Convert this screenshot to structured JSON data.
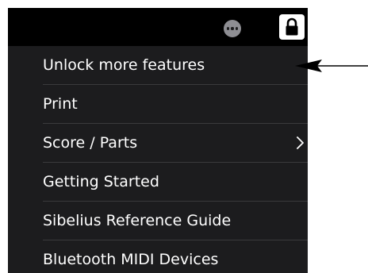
{
  "menu": {
    "items": [
      {
        "label": "Unlock more features",
        "has_submenu": false
      },
      {
        "label": "Print",
        "has_submenu": false
      },
      {
        "label": "Score / Parts",
        "has_submenu": true
      },
      {
        "label": "Getting Started",
        "has_submenu": false
      },
      {
        "label": "Sibelius Reference Guide",
        "has_submenu": false
      },
      {
        "label": "Bluetooth MIDI Devices",
        "has_submenu": false
      }
    ]
  },
  "toolbar": {
    "more_icon": "ellipsis-circle-icon",
    "lock_icon": "lock-icon"
  },
  "annotation": {
    "icon": "arrow-left-icon"
  },
  "colors": {
    "topbar": "#000000",
    "menu_background": "#1c1c1e",
    "menu_text": "#ffffff",
    "separator": "#3a3a3c",
    "more_button": "#8e8e93"
  }
}
